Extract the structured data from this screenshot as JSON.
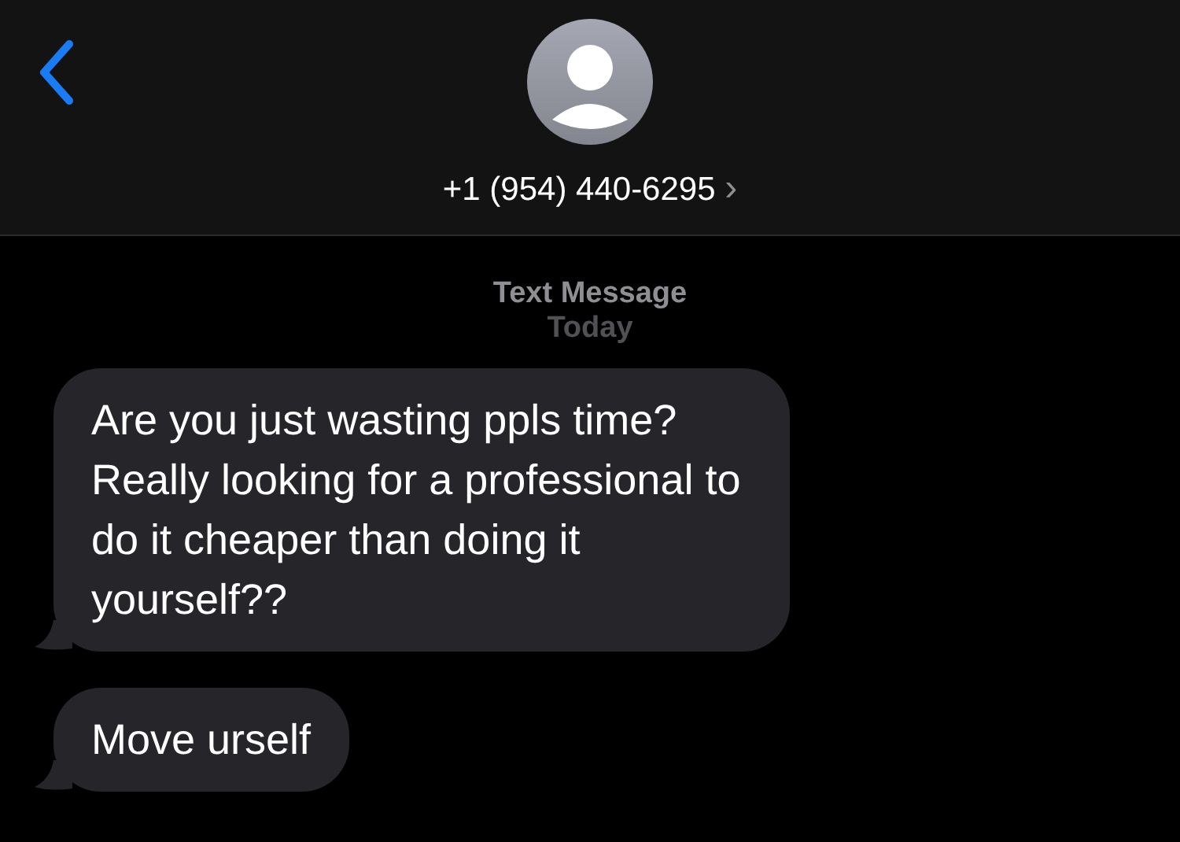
{
  "header": {
    "contact": "+1 (954) 440-6295",
    "chevron": "›"
  },
  "service_label": "Text Message",
  "timestamp": "Today",
  "messages": [
    {
      "text": "Are you just wasting ppls time? Really looking for a professional to do it cheaper than doing it yourself??"
    },
    {
      "text": "Move urself"
    }
  ]
}
